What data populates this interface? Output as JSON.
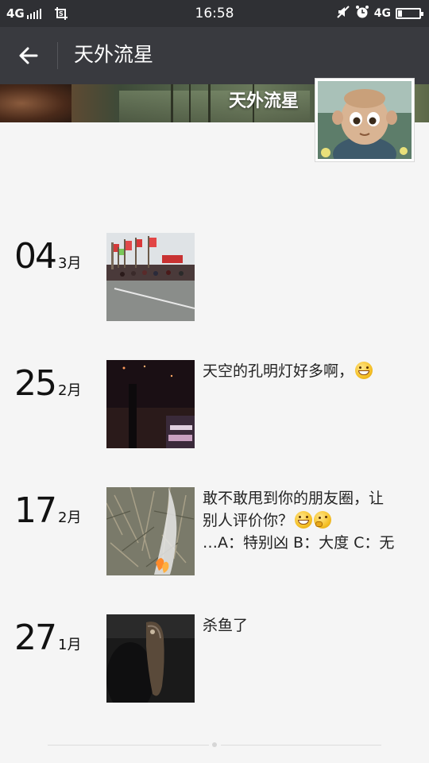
{
  "status_bar": {
    "network_left": "4G",
    "time": "16:58",
    "network_right": "4G",
    "icons": [
      "signal-bars-icon",
      "screenshot-icon",
      "mute-icon",
      "alarm-icon",
      "battery-icon"
    ],
    "battery_level": 0.15
  },
  "nav": {
    "back_icon": "arrow-left-icon",
    "title": "天外流星"
  },
  "profile": {
    "cover_name": "天外流星",
    "avatar_icon": "avatar-image"
  },
  "posts": [
    {
      "day": "04",
      "month": "3月",
      "text_lines": [],
      "emojis": []
    },
    {
      "day": "25",
      "month": "2月",
      "text_lines": [
        "天空的孔明灯好多啊，"
      ],
      "emojis": [
        "grin-emoji"
      ]
    },
    {
      "day": "17",
      "month": "2月",
      "text_lines": [
        "敢不敢甩到你的朋友圈，让",
        "别人评价你？",
        "…A：特别凶  B：大度  C：无"
      ],
      "emojis": [
        "grin-emoji",
        "thinking-emoji"
      ]
    },
    {
      "day": "27",
      "month": "1月",
      "text_lines": [
        "杀鱼了"
      ],
      "emojis": []
    }
  ],
  "colors": {
    "status_bar_bg": "#2f3034",
    "nav_bg": "#393a3f",
    "page_bg": "#f5f5f5"
  }
}
